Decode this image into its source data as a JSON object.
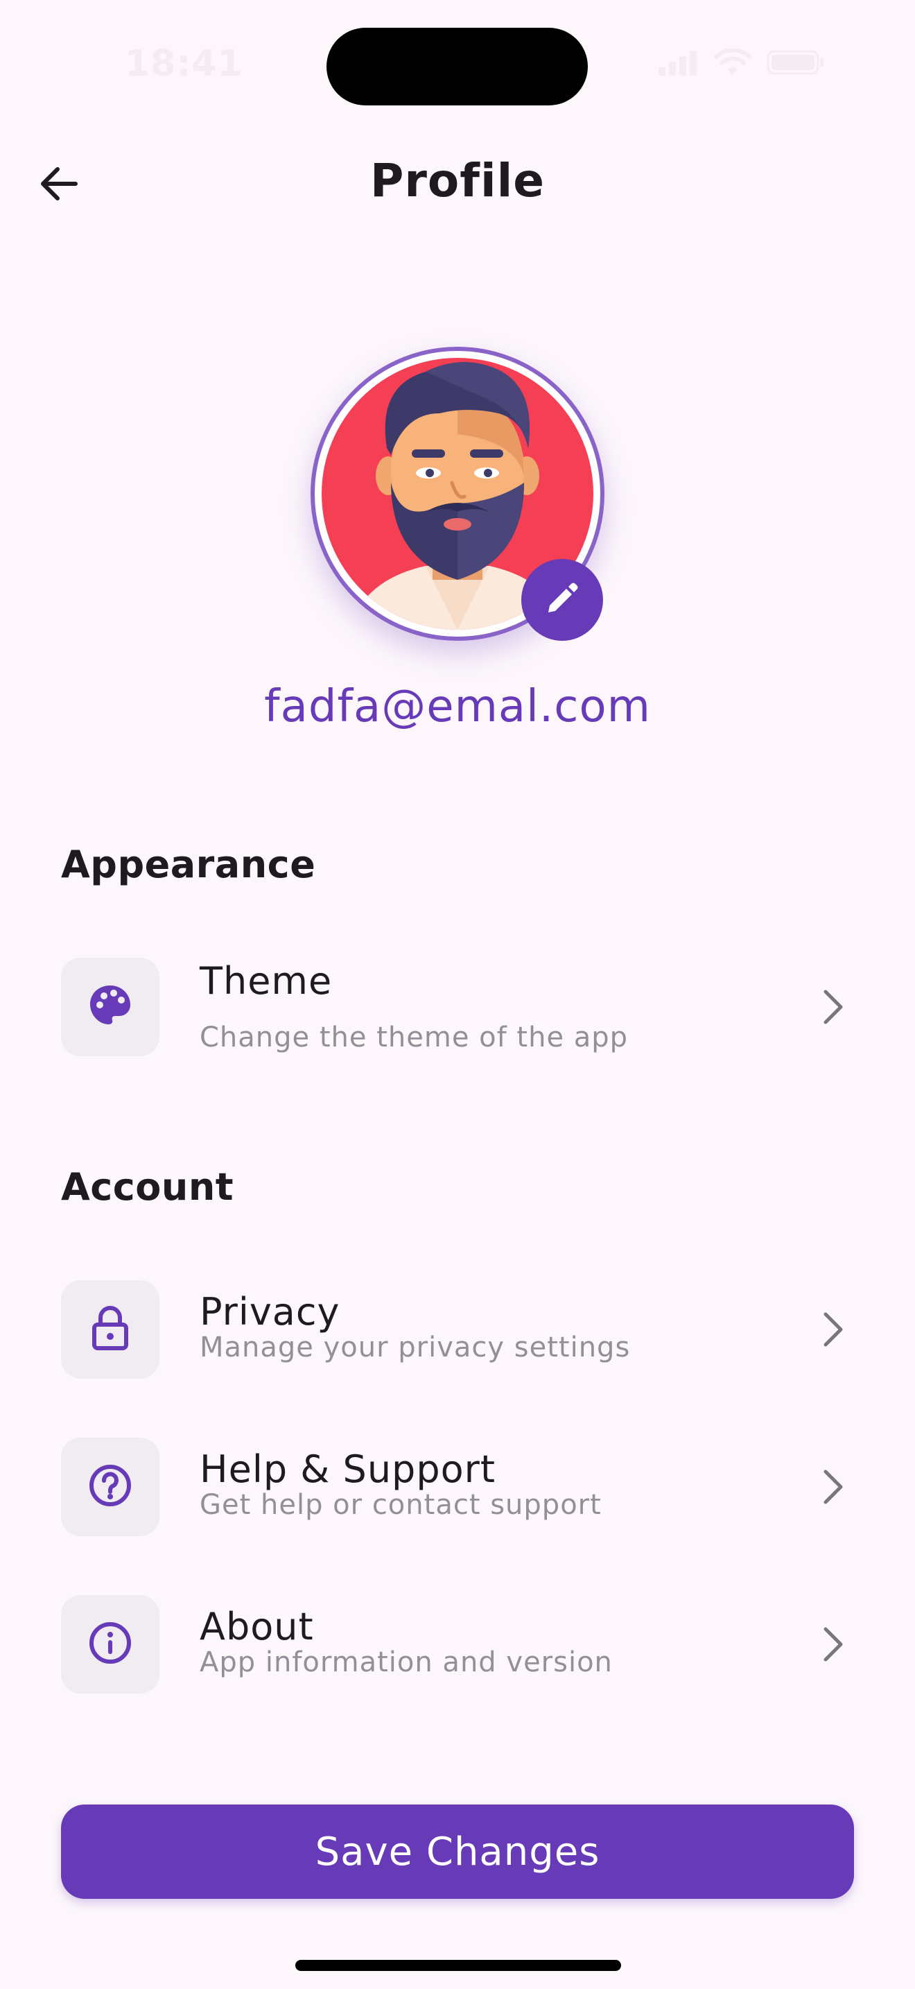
{
  "status_bar": {
    "time": "18:41"
  },
  "header": {
    "title": "Profile"
  },
  "profile": {
    "email": "fadfa@emal.com"
  },
  "sections": {
    "appearance": {
      "title": "Appearance",
      "items": [
        {
          "title": "Theme",
          "subtitle": "Change the theme of the app",
          "icon": "palette-icon"
        }
      ]
    },
    "account": {
      "title": "Account",
      "items": [
        {
          "title": "Privacy",
          "subtitle": "Manage your privacy settings",
          "icon": "lock-icon"
        },
        {
          "title": "Help & Support",
          "subtitle": "Get help or contact support",
          "icon": "help-icon"
        },
        {
          "title": "About",
          "subtitle": "App information and version",
          "icon": "info-icon"
        }
      ]
    }
  },
  "actions": {
    "save_label": "Save Changes"
  },
  "colors": {
    "background": "#fdf7fc",
    "accent": "#673ab7",
    "icon_box": "#f0ecf1",
    "subtitle": "#938f99",
    "avatar_bg": "#f43f55"
  }
}
